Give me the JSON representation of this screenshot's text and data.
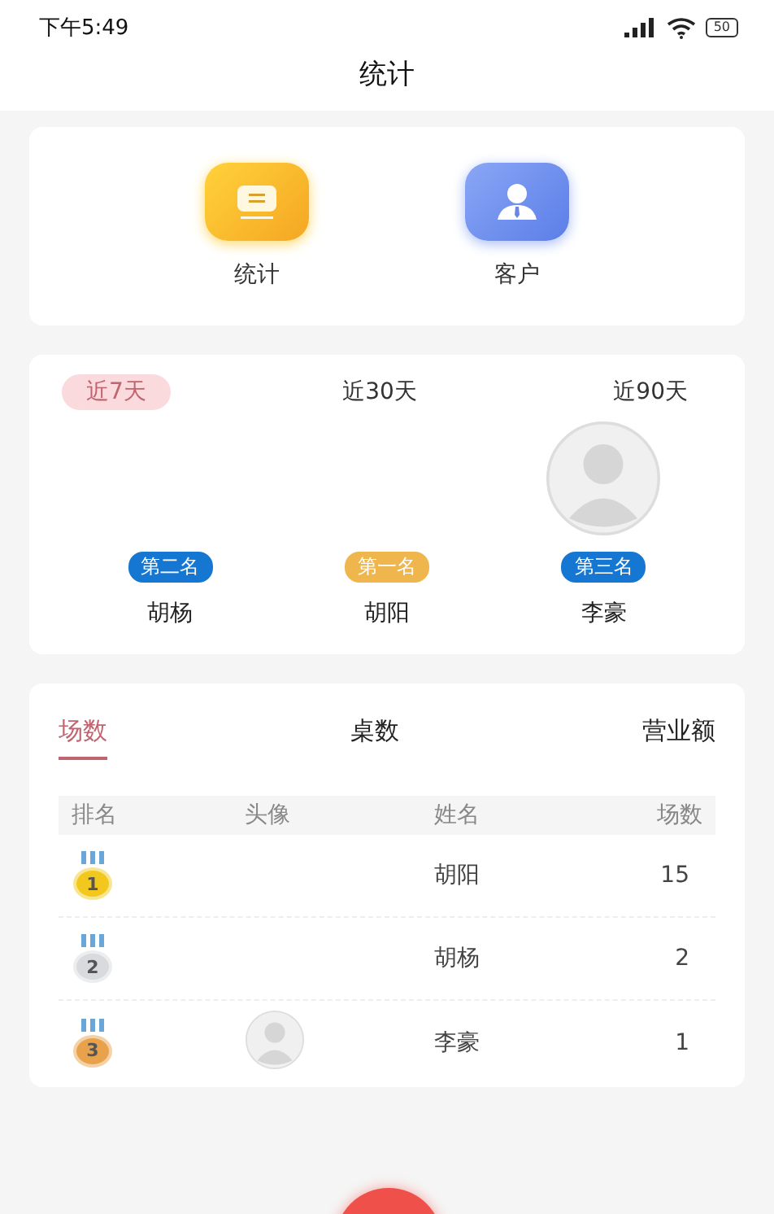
{
  "status_bar": {
    "time": "下午5:49",
    "battery": "50"
  },
  "header": {
    "title": "统计"
  },
  "shortcuts": [
    {
      "label": "统计",
      "kind": "stats"
    },
    {
      "label": "客户",
      "kind": "customer"
    }
  ],
  "periods": [
    {
      "label": "近7天",
      "selected": true
    },
    {
      "label": "近30天",
      "selected": false
    },
    {
      "label": "近90天",
      "selected": false
    }
  ],
  "podium": [
    {
      "badge": "第二名",
      "name": "胡杨",
      "avatar": false,
      "color": "#1677d2"
    },
    {
      "badge": "第一名",
      "name": "胡阳",
      "avatar": false,
      "color": "#f0b64e"
    },
    {
      "badge": "第三名",
      "name": "李豪",
      "avatar": true,
      "color": "#1677d2"
    }
  ],
  "metric_tabs": [
    {
      "label": "场数",
      "selected": true
    },
    {
      "label": "桌数",
      "selected": false
    },
    {
      "label": "营业额",
      "selected": false
    }
  ],
  "table": {
    "columns": [
      "排名",
      "头像",
      "姓名",
      "场数"
    ],
    "rows": [
      {
        "medal": "1",
        "color": "#f2c81e",
        "avatar": false,
        "name": "胡阳",
        "count": "15"
      },
      {
        "medal": "2",
        "color": "#d8dadd",
        "avatar": false,
        "name": "胡杨",
        "count": "2"
      },
      {
        "medal": "3",
        "color": "#e9a24c",
        "avatar": true,
        "name": "李豪",
        "count": "1"
      }
    ]
  }
}
